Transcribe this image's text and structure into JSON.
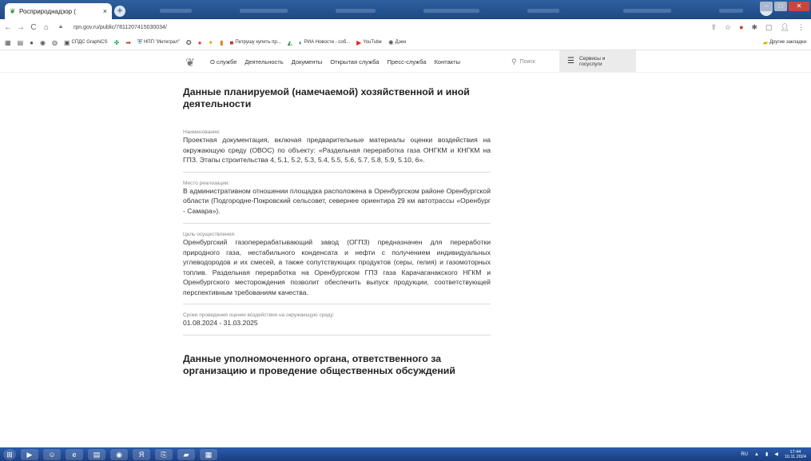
{
  "browser": {
    "tab_title": "Росприроднадзор (",
    "tab_close": "×",
    "new_tab": "+",
    "url": "rpn.gov.ru/public/7811207415030034/",
    "bookmarks": [
      {
        "icon": "apps-icon",
        "label": ""
      },
      {
        "icon": "doc-icon",
        "label": ""
      },
      {
        "icon": "github-icon",
        "label": ""
      },
      {
        "icon": "chrome-icon",
        "label": ""
      },
      {
        "icon": "ai-icon",
        "label": ""
      },
      {
        "icon": "file-icon",
        "label": "СПДС GraphiCS"
      },
      {
        "icon": "colorful-icon",
        "label": ""
      },
      {
        "icon": "arrow-icon",
        "label": ""
      },
      {
        "icon": "shield-icon",
        "label": "НПП \"Интеграл\""
      },
      {
        "icon": "badge-icon",
        "label": ""
      },
      {
        "icon": "red-icon",
        "label": ""
      },
      {
        "icon": "yellow-icon",
        "label": ""
      },
      {
        "icon": "orange-icon",
        "label": ""
      },
      {
        "icon": "store-icon",
        "label": "Петрушу купить пр..."
      },
      {
        "icon": "leaf-icon",
        "label": ""
      },
      {
        "icon": "news-icon",
        "label": "РИА Новости - соб..."
      },
      {
        "icon": "youtube-icon",
        "label": "YouTube"
      },
      {
        "icon": "dzen-icon",
        "label": "Дзен"
      }
    ],
    "other_bookmarks": "Другие закладки"
  },
  "site": {
    "nav": [
      "О службе",
      "Деятельность",
      "Документы",
      "Открытая служба",
      "Пресс-служба",
      "Контакты"
    ],
    "search": "Поиск",
    "services_line1": "Сервисы и",
    "services_line2": "госуслуги"
  },
  "content": {
    "heading1": "Данные планируемой (намечаемой) хозяйственной и иной деятельности",
    "sections": [
      {
        "label": "Наименование:",
        "text": "Проектная документация, включая предварительные материалы оценки воздействия на окружающую среду (ОВОС) по объекту: «Раздельная переработка газа ОНГКМ и КНГКМ на ГПЗ. Этапы строительства 4, 5.1, 5.2, 5.3, 5.4, 5.5, 5.6, 5.7, 5.8, 5.9, 5.10, 6»."
      },
      {
        "label": "Место реализации:",
        "text": "В административном отношении площадка расположена в Оренбургском районе Оренбургской области (Подгородне-Покровский сельсовет, севернее ориентира 29 км автотрассы «Оренбург - Самара»)."
      },
      {
        "label": "Цель осуществления:",
        "text": "Оренбургский газоперерабатывающий завод (ОГПЗ) предназначен для переработки природного газа, нестабильного конденсата и нефти с получением индивидуальных углеводородов и их смесей, а также сопутствующих продуктов (серы, гелия) и газомоторных топлив. Раздельная переработка на Оренбургском ГПЗ газа Карачаганакского НГКМ и Оренбургского месторождения позволит обеспечить выпуск продукции, соответствующей перспективным требованиям качества."
      },
      {
        "label": "Сроки проведения оценки воздействия на окружающую среду:",
        "text": "01.08.2024 - 31.03.2025"
      }
    ],
    "heading2": "Данные уполномоченного органа, ответственного за организацию и проведение общественных обсуждений"
  },
  "taskbar": {
    "lang": "RU",
    "time": "17:44",
    "date": "10.11.2024"
  }
}
